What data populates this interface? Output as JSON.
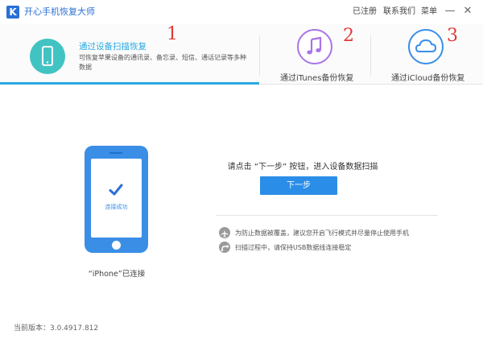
{
  "app": {
    "logo_letter": "K",
    "title": "开心手机恢复大师"
  },
  "topbar": {
    "registered": "已注册",
    "contact": "联系我们",
    "menu": "菜单"
  },
  "window_controls": {
    "minimize": "—",
    "close": "✕"
  },
  "tabs": [
    {
      "label": "通过设备扫描恢复",
      "description": "可恢复苹果设备的通讯录、备忘录、短信、通话记录等多种数据",
      "icon": "phone-icon",
      "active": true,
      "accent": "#41c3c3"
    },
    {
      "label": "通过iTunes备份恢复",
      "icon": "music-note-icon",
      "active": false,
      "accent": "#a874e6"
    },
    {
      "label": "通过iCloud备份恢复",
      "icon": "cloud-icon",
      "active": false,
      "accent": "#3a8ee6"
    }
  ],
  "annotations": [
    "1",
    "2",
    "3"
  ],
  "device": {
    "status": "连接成功",
    "label": "“iPhone”已连接"
  },
  "main": {
    "prompt": "请点击 “下一步” 按钮，进入设备数据扫描",
    "next_button": "下一步",
    "tips": [
      "为防止数据被覆盖，建议您开启飞行模式并尽量停止使用手机",
      "扫描过程中，请保持USB数据线连接稳定"
    ]
  },
  "footer": {
    "version": "当前版本：3.0.4917.812"
  },
  "colors": {
    "primary": "#2a8ee8",
    "active_tab": "#2aa9e0",
    "annotation": "#e03a3a"
  }
}
